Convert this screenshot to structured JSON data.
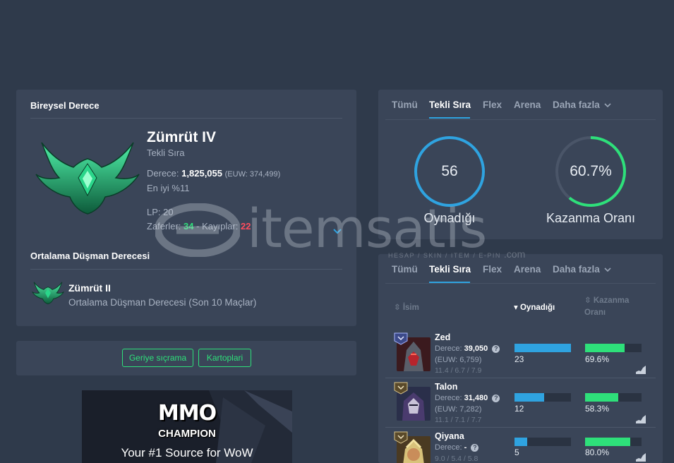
{
  "solo": {
    "title": "Bireysel Derece",
    "tier": "Zümrüt IV",
    "queue": "Tekli Sıra",
    "rating_label": "Derece:",
    "rating_value": "1,825,055",
    "rating_euw": "(EUW: 374,499)",
    "best": "En iyi %11",
    "lp": "LP: 20",
    "wins_label": "Zaferler:",
    "wins": "34",
    "dash": "-",
    "losses_label": "Kayıplar:",
    "losses": "22"
  },
  "avg_enemy": {
    "title": "Ortalama Düşman Derecesi",
    "tier": "Zümrüt II",
    "subtitle": "Ortalama Düşman Derecesi (Son 10 Maçlar)"
  },
  "buttons": {
    "rewind": "Geriye sıçrama",
    "cards": "Kartoplari"
  },
  "ad": {
    "logo_line1": "MMO",
    "logo_line2": "CHAMPION",
    "tagline": "Your #1 Source for WoW"
  },
  "tabs": [
    "Tümü",
    "Tekli Sıra",
    "Flex",
    "Arena",
    "Daha fazla"
  ],
  "stats": {
    "played_value": "56",
    "played_label": "Oynadığı",
    "winrate_value": "60.7%",
    "winrate_fraction": 0.607,
    "winrate_label": "Kazanma Oranı",
    "colors": {
      "played": "#2fa3e0",
      "winrate": "#2ee07a"
    }
  },
  "champ_table": {
    "col_name": "İsim",
    "col_played": "Oynadığı",
    "col_winrate_1": "Kazanma",
    "col_winrate_2": "Oranı",
    "rows": [
      {
        "name": "Zed",
        "rank_label": "Derece:",
        "rank": "39,050",
        "euw": "(EUW: 6,759)",
        "kda": "11.4 / 6.7 / 7.9",
        "played": "23",
        "played_fraction": 1.0,
        "winrate": "69.6%",
        "winrate_fraction": 0.696
      },
      {
        "name": "Talon",
        "rank_label": "Derece:",
        "rank": "31,480",
        "euw": "(EUW: 7,282)",
        "kda": "11.1 / 7.1 / 7.7",
        "played": "12",
        "played_fraction": 0.52,
        "winrate": "58.3%",
        "winrate_fraction": 0.583
      },
      {
        "name": "Qiyana",
        "rank_label": "Derece:",
        "rank": "-",
        "euw": "",
        "kda": "9.0 / 5.4 / 5.8",
        "played": "5",
        "played_fraction": 0.22,
        "winrate": "80.0%",
        "winrate_fraction": 0.8
      }
    ]
  },
  "watermark": {
    "text": "itemsatis",
    "sub": "HESAP / SKIN / ITEM / E-PIN",
    "tld": ".com"
  }
}
